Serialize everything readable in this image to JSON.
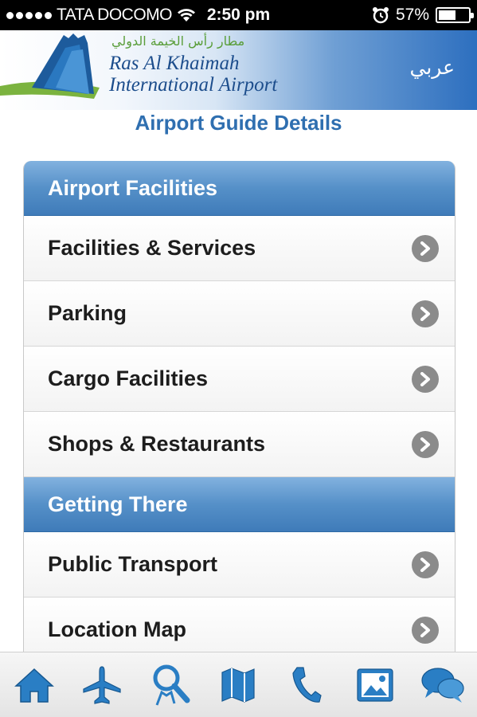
{
  "status_bar": {
    "carrier": "TATA DOCOMO",
    "time": "2:50 pm",
    "battery": "57%",
    "battery_level": 0.57
  },
  "header": {
    "arabic_name": "مطار رأس الخيمة الدولي",
    "name_line1": "Ras Al Khaimah",
    "name_line2": "International Airport",
    "language_link": "عربي"
  },
  "page_title": "Airport Guide Details",
  "sections": [
    {
      "title": "Airport Facilities",
      "items": [
        "Facilities & Services",
        "Parking",
        "Cargo Facilities",
        "Shops & Restaurants"
      ]
    },
    {
      "title": "Getting There",
      "items": [
        "Public Transport",
        "Location Map"
      ]
    }
  ],
  "tabs": [
    "home-icon",
    "airplane-icon",
    "search-people-icon",
    "map-icon",
    "phone-icon",
    "gallery-icon",
    "chat-icon"
  ],
  "colors": {
    "accent": "#2f6fb0",
    "section_header": "#4f8ac4",
    "tab_icon": "#2a7ec4"
  }
}
